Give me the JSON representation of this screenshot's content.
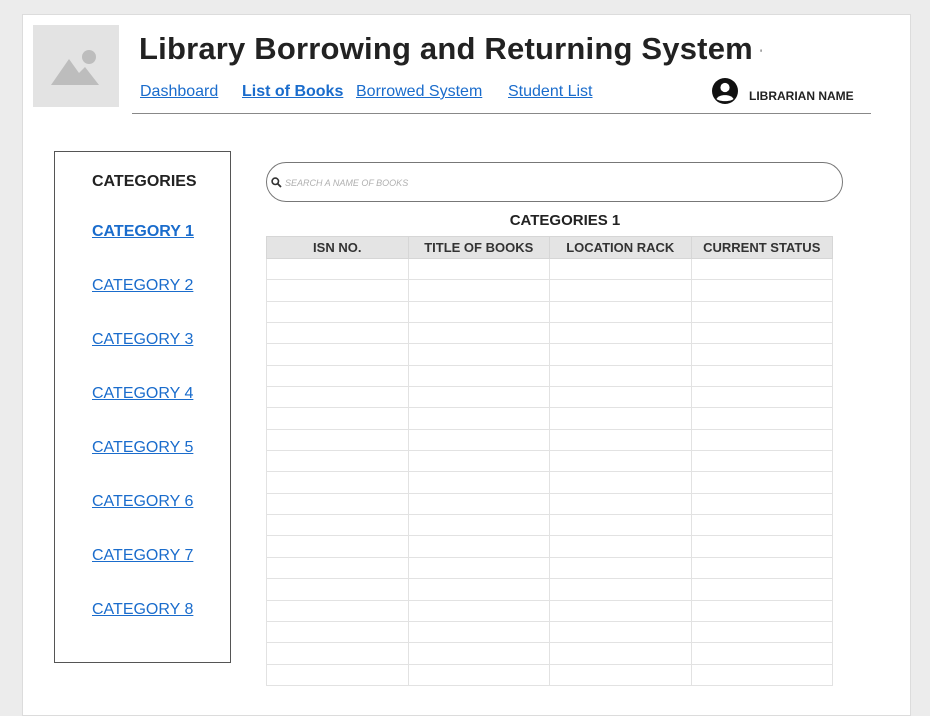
{
  "header": {
    "title": "Library Borrowing and Returning System",
    "title_trailing_mark": "'",
    "nav": [
      {
        "label": "Dashboard",
        "active": false
      },
      {
        "label": "List of Books",
        "active": true
      },
      {
        "label": "Borrowed System",
        "active": false
      },
      {
        "label": "Student List",
        "active": false
      }
    ],
    "user_name": "LIBRARIAN NAME"
  },
  "icons": {
    "logo": "image-placeholder-icon",
    "user": "user-circle-icon",
    "search": "search-icon"
  },
  "sidebar": {
    "heading": "CATEGORIES",
    "items": [
      {
        "label": "CATEGORY 1",
        "active": true
      },
      {
        "label": "CATEGORY 2",
        "active": false
      },
      {
        "label": "CATEGORY 3",
        "active": false
      },
      {
        "label": "CATEGORY 4",
        "active": false
      },
      {
        "label": "CATEGORY 5",
        "active": false
      },
      {
        "label": "CATEGORY 6",
        "active": false
      },
      {
        "label": "CATEGORY 7",
        "active": false
      },
      {
        "label": "CATEGORY 8",
        "active": false
      }
    ]
  },
  "search": {
    "placeholder": "SEARCH A NAME OF BOOKS",
    "value": ""
  },
  "table": {
    "title": "CATEGORIES 1",
    "columns": [
      "ISN NO.",
      "TITLE OF BOOKS",
      "LOCATION RACK",
      "CURRENT STATUS"
    ],
    "rows": [
      [
        "",
        "",
        "",
        ""
      ],
      [
        "",
        "",
        "",
        ""
      ],
      [
        "",
        "",
        "",
        ""
      ],
      [
        "",
        "",
        "",
        ""
      ],
      [
        "",
        "",
        "",
        ""
      ],
      [
        "",
        "",
        "",
        ""
      ],
      [
        "",
        "",
        "",
        ""
      ],
      [
        "",
        "",
        "",
        ""
      ],
      [
        "",
        "",
        "",
        ""
      ],
      [
        "",
        "",
        "",
        ""
      ],
      [
        "",
        "",
        "",
        ""
      ],
      [
        "",
        "",
        "",
        ""
      ],
      [
        "",
        "",
        "",
        ""
      ],
      [
        "",
        "",
        "",
        ""
      ],
      [
        "",
        "",
        "",
        ""
      ],
      [
        "",
        "",
        "",
        ""
      ],
      [
        "",
        "",
        "",
        ""
      ],
      [
        "",
        "",
        "",
        ""
      ],
      [
        "",
        "",
        "",
        ""
      ],
      [
        "",
        "",
        "",
        ""
      ]
    ]
  },
  "colors": {
    "link": "#1a6ccc",
    "table_header_bg": "#e4e4e4",
    "page_bg": "#ececec"
  }
}
